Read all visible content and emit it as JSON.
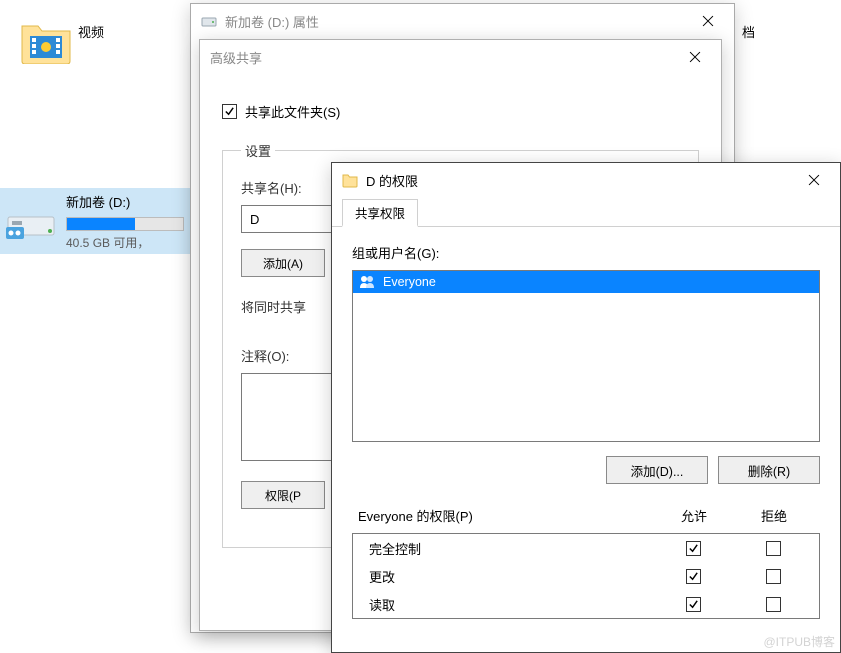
{
  "desktop": {
    "video_label": "视频",
    "stray_label": "档"
  },
  "drive": {
    "name": "新加卷 (D:)",
    "sub": "40.5 GB 可用，"
  },
  "properties": {
    "title": "新加卷 (D:) 属性"
  },
  "advshare": {
    "title": "高级共享",
    "share_checkbox": "共享此文件夹(S)",
    "settings_legend": "设置",
    "share_name_label": "共享名(H):",
    "share_name_value": "D",
    "add_btn": "添加(A)",
    "simultaneous_label": "将同时共享",
    "comment_label": "注释(O):",
    "perm_btn": "权限(P"
  },
  "perm": {
    "title": "D 的权限",
    "tab_label": "共享权限",
    "group_label": "组或用户名(G):",
    "groups": [
      {
        "name": "Everyone"
      }
    ],
    "add_btn": "添加(D)...",
    "remove_btn": "删除(R)",
    "perm_for_label": "Everyone 的权限(P)",
    "col_allow": "允许",
    "col_deny": "拒绝",
    "rows": [
      {
        "label": "完全控制",
        "allow": true,
        "deny": false
      },
      {
        "label": "更改",
        "allow": true,
        "deny": false
      },
      {
        "label": "读取",
        "allow": true,
        "deny": false
      }
    ]
  },
  "watermark": "@ITPUB博客"
}
